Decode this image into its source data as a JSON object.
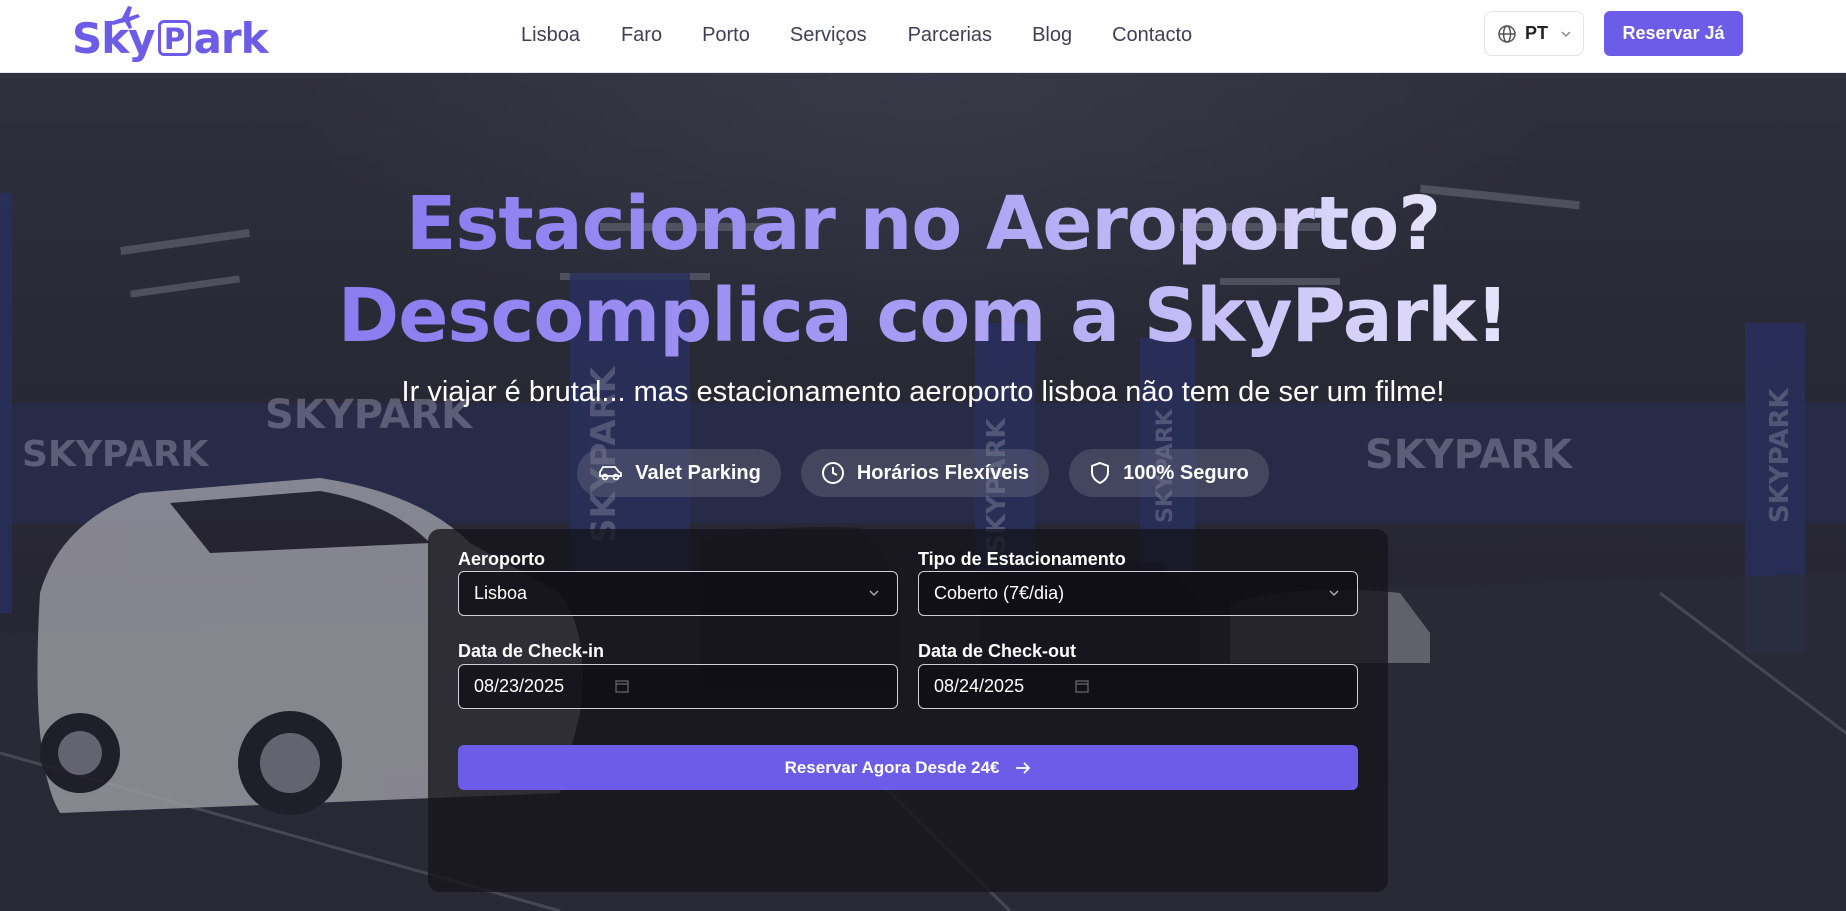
{
  "brand": {
    "name_prefix": "Sky",
    "name_p": "P",
    "name_suffix": "ark",
    "accent": "#6c5ce7"
  },
  "nav": {
    "items": [
      "Lisboa",
      "Faro",
      "Porto",
      "Serviços",
      "Parcerias",
      "Blog",
      "Contacto"
    ]
  },
  "language": {
    "code": "PT"
  },
  "header": {
    "cta_label": "Reservar Já"
  },
  "hero": {
    "title_line1": "Estacionar no Aeroporto?",
    "title_line2": "Descomplica com a SkyPark!",
    "subtitle": "Ir viajar é brutal... mas estacionamento aeroporto lisboa não tem de ser um filme!",
    "features": [
      {
        "label": "Valet Parking",
        "icon": "car-icon"
      },
      {
        "label": "Horários Flexíveis",
        "icon": "clock-icon"
      },
      {
        "label": "100% Seguro",
        "icon": "shield-icon"
      }
    ],
    "bg_signs": [
      "SKYPARK",
      "SKYPARK",
      "SKYPARK",
      "SKYPARK",
      "SKYPARK",
      "SKYPARK",
      "SKYPARK"
    ]
  },
  "booking_form": {
    "airport_label": "Aeroporto",
    "airport_value": "Lisboa",
    "parking_type_label": "Tipo de Estacionamento",
    "parking_type_value": "Coberto (7€/dia)",
    "checkin_label": "Data de Check-in",
    "checkin_value": "08/23/2025",
    "checkout_label": "Data de Check-out",
    "checkout_value": "08/24/2025",
    "submit_label": "Reservar Agora Desde 24€"
  }
}
